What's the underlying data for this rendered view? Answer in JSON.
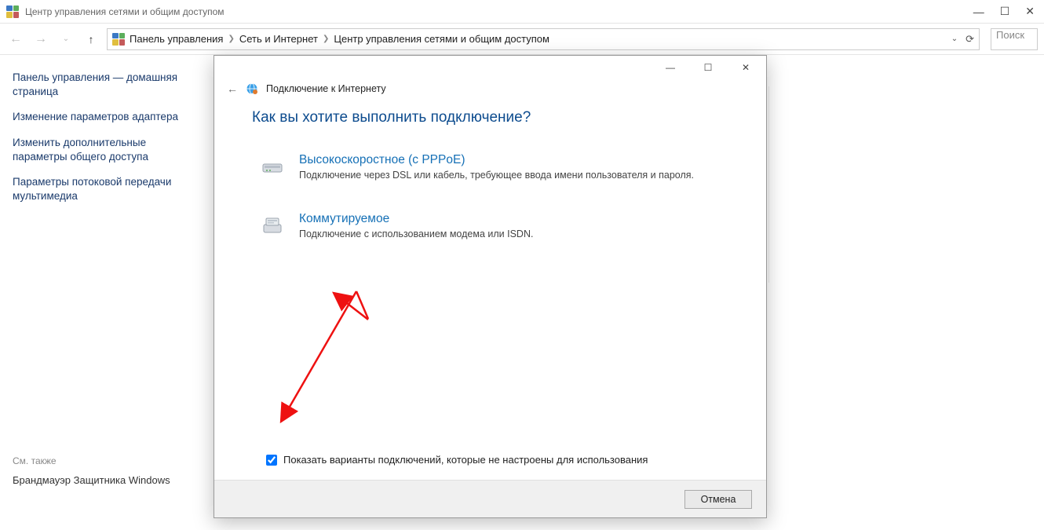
{
  "window": {
    "title": "Центр управления сетями и общим доступом"
  },
  "breadcrumbs": {
    "0": "Панель управления",
    "1": "Сеть и Интернет",
    "2": "Центр управления сетями и общим доступом"
  },
  "search": {
    "placeholder": "Поиск"
  },
  "sidebar": {
    "links": {
      "0": "Панель управления — домашняя страница",
      "1": "Изменение параметров адаптера",
      "2": "Изменить дополнительные параметры общего доступа",
      "3": "Параметры потоковой передачи мультимедиа"
    },
    "see_also_title": "См. также",
    "see_also_0": "Брандмауэр Защитника Windows"
  },
  "dialog": {
    "header_title": "Подключение к Интернету",
    "heading": "Как вы хотите выполнить подключение?",
    "options": {
      "0": {
        "title": "Высокоскоростное (с PPPoE)",
        "desc": "Подключение через DSL или кабель, требующее ввода имени пользователя и пароля."
      },
      "1": {
        "title": "Коммутируемое",
        "desc": "Подключение с использованием модема или ISDN."
      }
    },
    "checkbox_label": "Показать варианты подключений, которые не настроены для использования",
    "cancel": "Отмена"
  }
}
